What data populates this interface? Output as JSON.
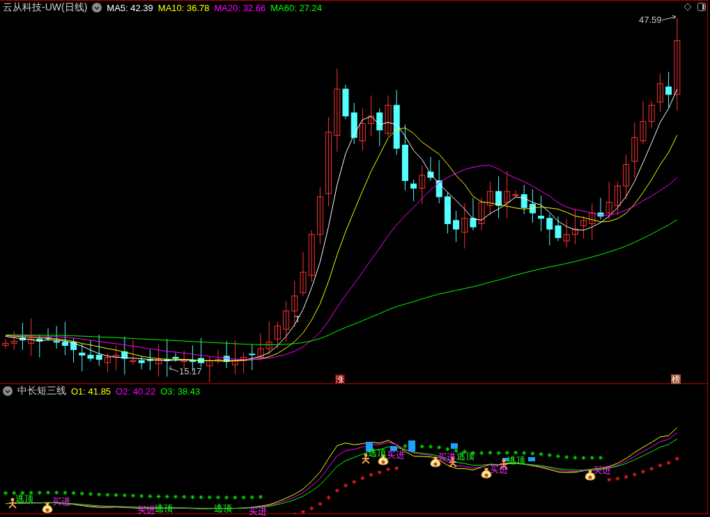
{
  "main_panel": {
    "title": "云从科技-UW(日线)",
    "indicators": [
      {
        "label": "MA5: 42.39",
        "color": "#ffffff"
      },
      {
        "label": "MA10: 36.78",
        "color": "#ffff00"
      },
      {
        "label": "MA20: 32.66",
        "color": "#ff00ff"
      },
      {
        "label": "MA60: 27.24",
        "color": "#00ff00"
      }
    ],
    "high_label": "47.59",
    "low_label": "15.17",
    "marker_text": "T",
    "badges": [
      {
        "text": "涨",
        "kind": "rise"
      },
      {
        "text": "榜",
        "kind": "rank"
      }
    ]
  },
  "sub_panel": {
    "title": "中长短三线",
    "indicators": [
      {
        "label": "O1: 41.85",
        "color": "#ffff00"
      },
      {
        "label": "O2: 40.22",
        "color": "#ff00ff"
      },
      {
        "label": "O3: 38.43",
        "color": "#00ff00"
      }
    ],
    "signals": [
      {
        "kind": "sell",
        "label": "逃顶"
      },
      {
        "kind": "buy",
        "label": "买进"
      },
      {
        "kind": "buy",
        "label": "买进"
      },
      {
        "kind": "sell",
        "label": "逃顶"
      },
      {
        "kind": "sell",
        "label": "逃顶"
      },
      {
        "kind": "buy",
        "label": "买进"
      },
      {
        "kind": "sell",
        "label": "逃顶"
      },
      {
        "kind": "buy",
        "label": "买进"
      },
      {
        "kind": "buy",
        "label": "买进"
      },
      {
        "kind": "sell",
        "label": "逃顶"
      },
      {
        "kind": "buy",
        "label": "买进"
      },
      {
        "kind": "sell",
        "label": "逃顶"
      },
      {
        "kind": "buy",
        "label": "买进"
      }
    ]
  }
}
